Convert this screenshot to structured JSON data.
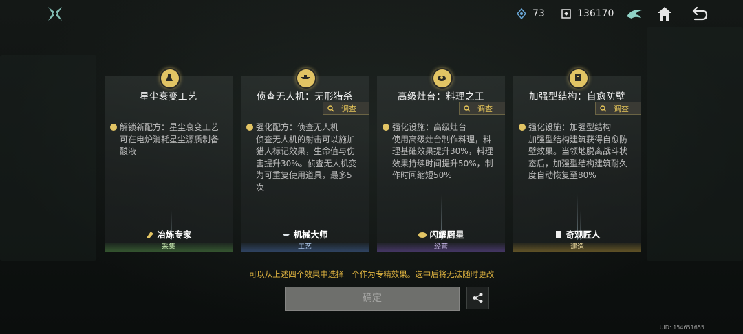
{
  "topbar": {
    "resource1_value": "73",
    "resource2_value": "136170",
    "icons": [
      "game-logo-icon",
      "crystal-icon",
      "currency-icon",
      "eagle-emblem-icon",
      "home-icon",
      "back-icon"
    ]
  },
  "cards": [
    {
      "title": "星尘衰变工艺",
      "search_label": "",
      "desc_lines": [
        "解锁新配方：星尘衰变工艺",
        "可在电炉消耗星尘源质制备",
        "酸液"
      ],
      "role": "冶炼专家",
      "category": "采集",
      "category_color": "#4a7a40",
      "icon": "flask-emblem-icon"
    },
    {
      "title": "侦查无人机：无形猎杀",
      "search_label": "调查",
      "desc_lines": [
        "强化配方：侦查无人机",
        "侦查无人机的射击可以施加",
        "猎人标记效果，生命值与伤",
        "害提升30%。侦查无人机变",
        "为可重复使用道具，最多5",
        "次"
      ],
      "role": "机械大师",
      "category": "工艺",
      "category_color": "#3c5a8a",
      "icon": "drone-emblem-icon"
    },
    {
      "title": "高级灶台：料理之王",
      "search_label": "调查",
      "desc_lines": [
        "强化设施：高级灶台",
        "使用高级灶台制作料理，料",
        "理基础效果提升30%，料理",
        "效果持续时间提升50%，制",
        "作时间缩短50%"
      ],
      "role": "闪耀厨星",
      "category": "经营",
      "category_color": "#5e4690",
      "icon": "dish-emblem-icon"
    },
    {
      "title": "加强型结构：自愈防壁",
      "search_label": "调查",
      "desc_lines": [
        "强化设施：加强型结构",
        "加强型结构建筑获得自愈防",
        "壁效果。当领地脱离战斗状",
        "态后，加强型结构建筑耐久",
        "度自动恢复至80%"
      ],
      "role": "奇观匠人",
      "category": "建造",
      "category_color": "#8a7330",
      "icon": "structure-emblem-icon"
    }
  ],
  "hint": "可以从上述四个效果中选择一个作为专精效果。选中后将无法随时更改",
  "confirm_label": "确定",
  "uid": "UID: 154651655"
}
